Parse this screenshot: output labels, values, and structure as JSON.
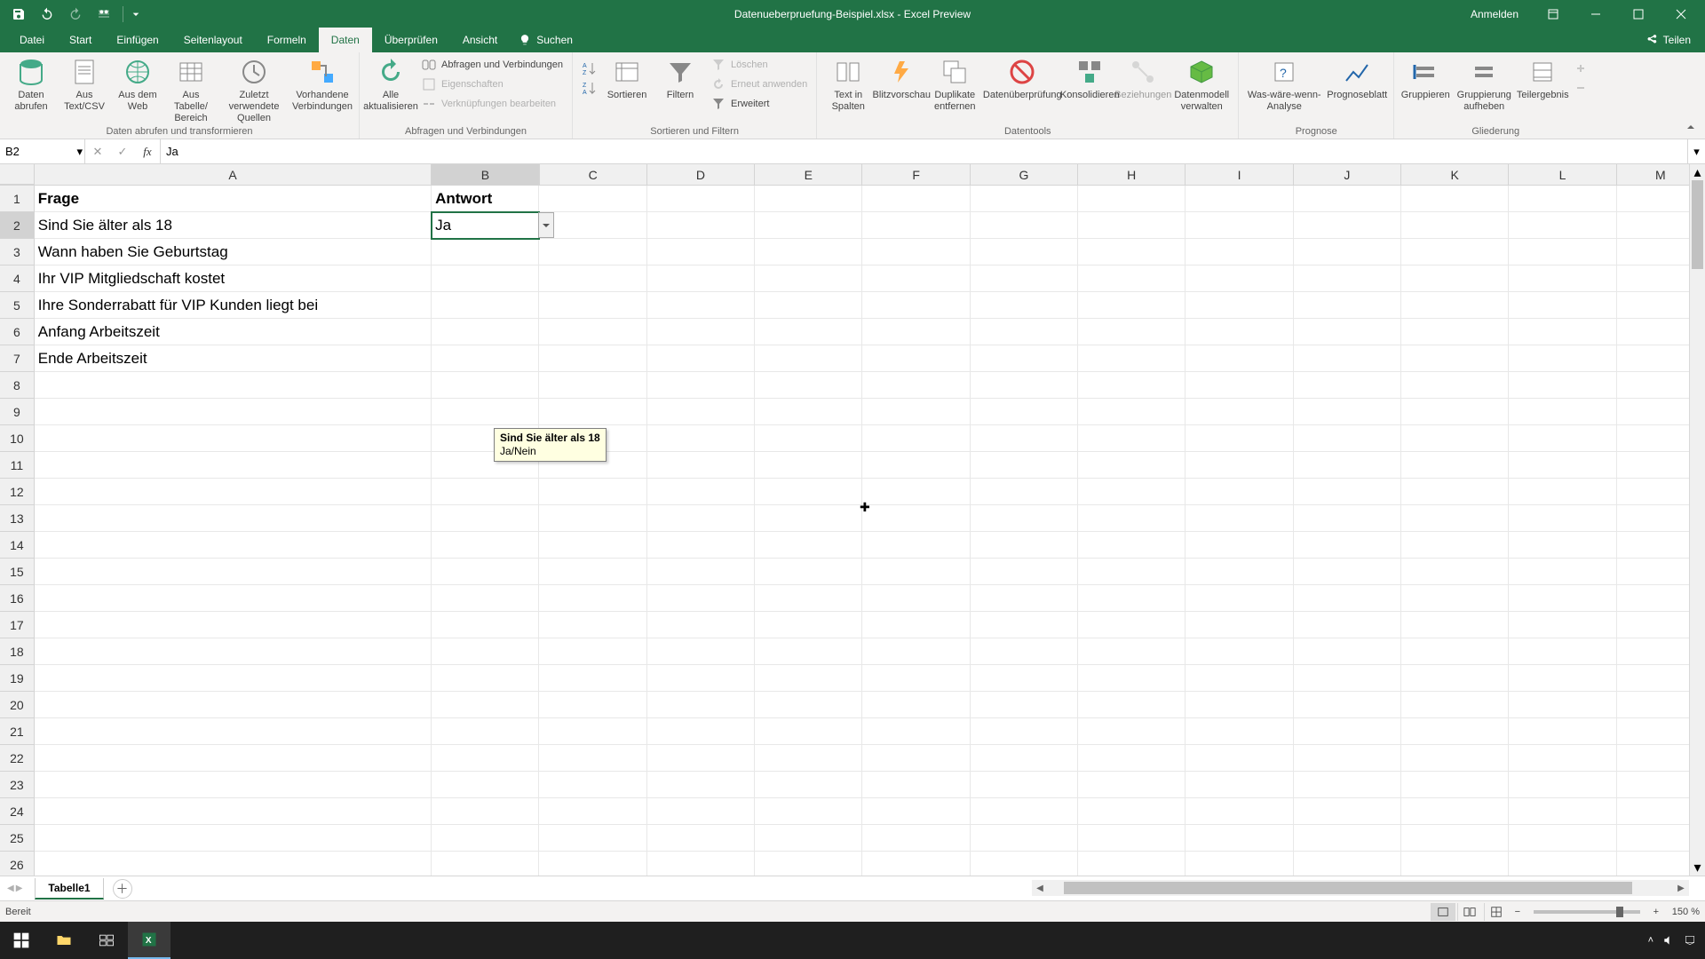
{
  "title": "Datenueberpruefung-Beispiel.xlsx - Excel Preview",
  "signin": "Anmelden",
  "tabs": {
    "datei": "Datei",
    "start": "Start",
    "einfuegen": "Einfügen",
    "seitenlayout": "Seitenlayout",
    "formeln": "Formeln",
    "daten": "Daten",
    "ueberpruefen": "Überprüfen",
    "ansicht": "Ansicht",
    "suchen": "Suchen",
    "teilen": "Teilen"
  },
  "ribbon": {
    "group1": {
      "label": "Daten abrufen und transformieren",
      "daten_abrufen": "Daten\nabrufen",
      "aus_textcsv": "Aus\nText/CSV",
      "aus_web": "Aus dem\nWeb",
      "aus_tabelle": "Aus Tabelle/\nBereich",
      "zuletzt": "Zuletzt verwendete\nQuellen",
      "vorhandene": "Vorhandene\nVerbindungen"
    },
    "group2": {
      "label": "Abfragen und Verbindungen",
      "alle_akt": "Alle\naktualisieren",
      "abfragen": "Abfragen und Verbindungen",
      "eigenschaften": "Eigenschaften",
      "verknuepfungen": "Verknüpfungen bearbeiten"
    },
    "group3": {
      "label": "Sortieren und Filtern",
      "az": "A↓Z",
      "za": "Z↓A",
      "sortieren": "Sortieren",
      "filtern": "Filtern",
      "loeschen": "Löschen",
      "erneut": "Erneut anwenden",
      "erweitert": "Erweitert"
    },
    "group4": {
      "label": "Datentools",
      "text_spalten": "Text in\nSpalten",
      "blitzvorschau": "Blitzvorschau",
      "duplikate": "Duplikate\nentfernen",
      "datenueberpruefung": "Datenüberprüfung",
      "konsolidieren": "Konsolidieren",
      "beziehungen": "Beziehungen",
      "datenmodell": "Datenmodell\nverwalten"
    },
    "group5": {
      "label": "Prognose",
      "was_waere": "Was-wäre-wenn-\nAnalyse",
      "prognoseblatt": "Prognoseblatt"
    },
    "group6": {
      "label": "Gliederung",
      "gruppieren": "Gruppieren",
      "gruppierung_aufheben": "Gruppierung\naufheben",
      "teilergebnis": "Teilergebnis"
    }
  },
  "name_box": "B2",
  "formula_value": "Ja",
  "columns": [
    "A",
    "B",
    "C",
    "D",
    "E",
    "F",
    "G",
    "H",
    "I",
    "J",
    "K",
    "L",
    "M"
  ],
  "rows": [
    "1",
    "2",
    "3",
    "4",
    "5",
    "6",
    "7",
    "8",
    "9",
    "10",
    "11",
    "12",
    "13",
    "14",
    "15",
    "16",
    "17",
    "18",
    "19",
    "20",
    "21",
    "22",
    "23",
    "24",
    "25",
    "26"
  ],
  "cells": {
    "A1": "Frage",
    "B1": "Antwort",
    "A2": "Sind Sie älter als 18",
    "B2": "Ja",
    "A3": "Wann haben Sie Geburtstag",
    "A4": "Ihr VIP Mitgliedschaft kostet",
    "A5": "Ihre Sonderrabatt für VIP Kunden liegt bei",
    "A6": "Anfang Arbeitszeit",
    "A7": "Ende Arbeitszeit"
  },
  "tooltip": {
    "title": "Sind Sie älter als 18",
    "body": "Ja/Nein"
  },
  "sheet": {
    "name": "Tabelle1"
  },
  "status": {
    "ready": "Bereit",
    "zoom": "150 %"
  }
}
